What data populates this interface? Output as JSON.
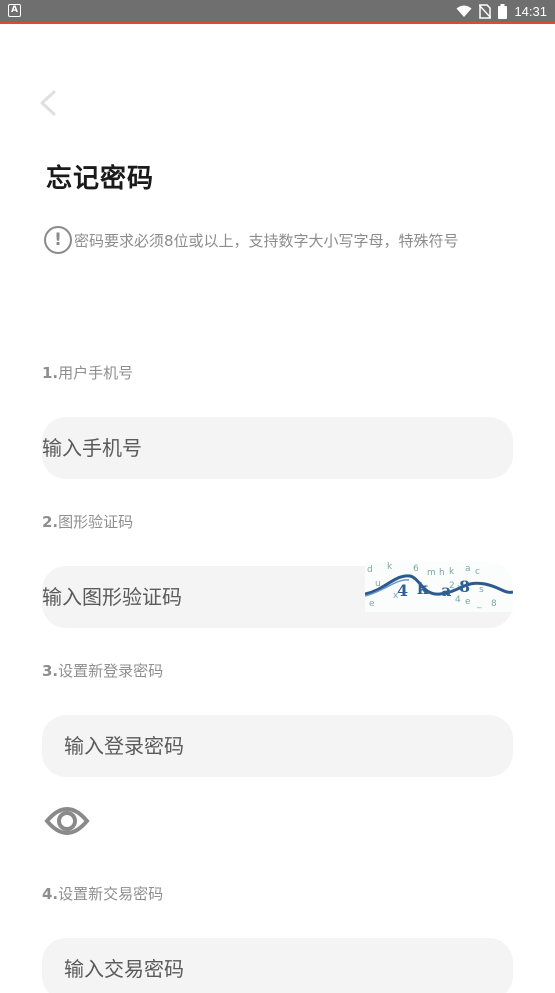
{
  "status_bar": {
    "time": "14:31",
    "left_icon": "A",
    "icons": [
      "wifi-icon",
      "no-sim-icon",
      "battery-icon"
    ]
  },
  "page": {
    "title": "忘记密码",
    "hint": "密码要求必须8位或以上，支持数字大小写字母，特殊符号",
    "hint_icon": "!"
  },
  "form": {
    "phone": {
      "label_num": "1.",
      "label": "用户手机号",
      "placeholder": "输入手机号"
    },
    "captcha": {
      "label_num": "2.",
      "label": "图形验证码",
      "placeholder": "输入图形验证码"
    },
    "login_password": {
      "label_num": "3.",
      "label": "设置新登录密码",
      "placeholder": "输入登录密码"
    },
    "trade_password": {
      "label_num": "4.",
      "label": "设置新交易密码",
      "placeholder": "输入交易密码"
    }
  },
  "colors": {
    "status_bar": "#6f6f6f",
    "accent": "#e0483a",
    "field_bg": "#f4f4f4",
    "label": "#8e8e8e"
  }
}
